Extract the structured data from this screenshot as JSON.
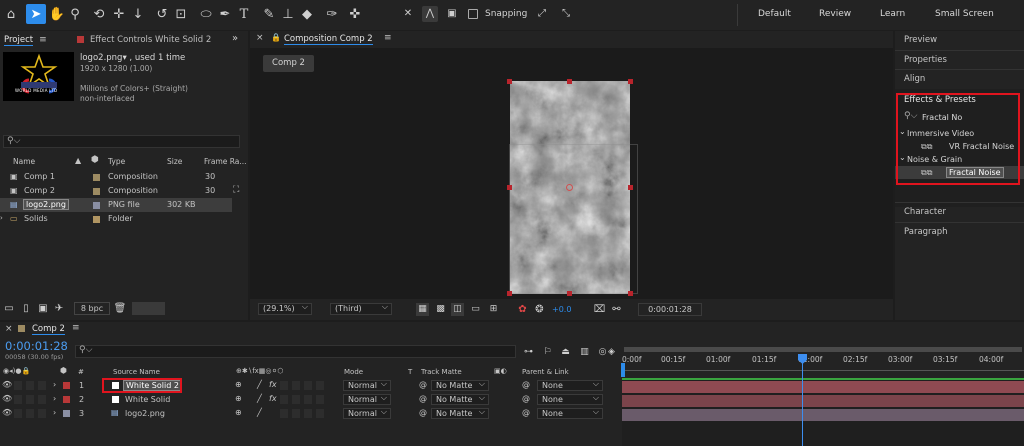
{
  "toolbar": {
    "tools": [
      "home-icon",
      "selection-tool-icon",
      "hand-tool-icon",
      "zoom-tool-icon",
      "orbit-camera-icon",
      "pan-camera-icon",
      "dolly-camera-icon",
      "rotation-tool-icon",
      "pan-behind-icon",
      "ellipse-tool-icon",
      "pen-tool-icon",
      "type-tool-icon",
      "brush-tool-icon",
      "clone-stamp-icon",
      "eraser-icon",
      "roto-brush-icon",
      "puppet-pin-icon"
    ],
    "snapping_label": "Snapping",
    "workspaces": [
      "Default",
      "Review",
      "Learn",
      "Small Screen"
    ]
  },
  "project": {
    "tab_project": "Project",
    "tab_effect_controls": "Effect Controls White Solid 2",
    "thumb_text": "WORLD MEDIA LTD",
    "item_name": "logo2.png▾ , used 1 time",
    "item_dims": "1920 x 1280 (1.00)",
    "item_colors": "Millions of Colors+ (Straight)",
    "item_interlace": "non-interlaced",
    "search_placeholder": "",
    "columns": {
      "name": "Name",
      "type": "Type",
      "size": "Size",
      "frame_rate": "Frame Ra..."
    },
    "rows": [
      {
        "name": "Comp 1",
        "type": "Composition",
        "size": "",
        "fr": "30",
        "swatch": "#9d8b62",
        "icon": "composition-icon"
      },
      {
        "name": "Comp 2",
        "type": "Composition",
        "size": "",
        "fr": "30",
        "swatch": "#9d8b62",
        "icon": "composition-icon"
      },
      {
        "name": "logo2.png",
        "type": "PNG file",
        "size": "302 KB",
        "fr": "",
        "swatch": "#8a8fa3",
        "icon": "png-file-icon"
      },
      {
        "name": "Solids",
        "type": "Folder",
        "size": "",
        "fr": "",
        "swatch": "#b09562",
        "icon": "folder-icon"
      }
    ],
    "bit_depth": "8 bpc"
  },
  "viewer": {
    "tab_title": "Composition Comp 2",
    "chip": "Comp 2",
    "zoom": "(29.1%)",
    "resolution": "(Third)",
    "exposure": "+0.0",
    "timecode": "0:00:01:28"
  },
  "right_panel": {
    "preview": "Preview",
    "properties": "Properties",
    "align": "Align",
    "effects_title": "Effects & Presets",
    "search_value": "Fractal No",
    "group1": "Immersive Video",
    "item1": "VR Fractal Noise",
    "group2": "Noise & Grain",
    "item2": "Fractal Noise",
    "character": "Character",
    "paragraph": "Paragraph"
  },
  "timeline": {
    "tab": "Comp 2",
    "timecode": "0:00:01:28",
    "frame_info": "00058 (30.00 fps)",
    "headers": {
      "num": "#",
      "source": "Source Name",
      "mode": "Mode",
      "t": "T",
      "track_matte": "Track Matte",
      "parent": "Parent & Link"
    },
    "layers": [
      {
        "num": "1",
        "name": "White Solid 2",
        "mode": "Normal",
        "matte": "No Matte",
        "parent": "None",
        "label": "#b83838",
        "fx": "fx"
      },
      {
        "num": "2",
        "name": "White Solid",
        "mode": "Normal",
        "matte": "No Matte",
        "parent": "None",
        "label": "#b83838",
        "fx": "fx"
      },
      {
        "num": "3",
        "name": "logo2.png",
        "mode": "Normal",
        "matte": "No Matte",
        "parent": "None",
        "label": "#8a8fa3",
        "fx": ""
      }
    ],
    "ruler": [
      "0:00f",
      "00:15f",
      "01:00f",
      "01:15f",
      "02:00f",
      "02:15f",
      "03:00f",
      "03:15f",
      "04:00f"
    ]
  },
  "colors": {
    "accent": "#2d8ceb",
    "highlight": "#e0141e",
    "track_green": "#39a43f",
    "layer_bar": "#8f4a52"
  }
}
